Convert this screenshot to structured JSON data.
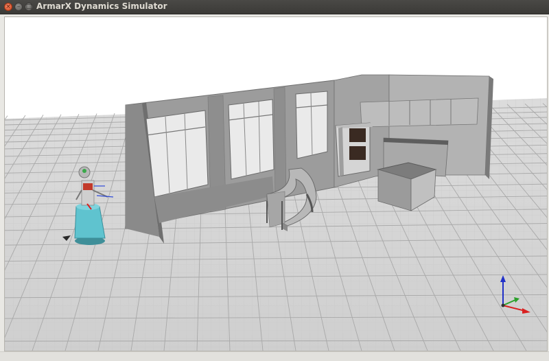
{
  "window": {
    "title": "ArmarX Dynamics Simulator",
    "close_glyph": "×",
    "minimize_glyph": "–",
    "maximize_glyph": "□"
  },
  "scene": {
    "background_color": "#ffffff",
    "floor_color": "#d8d8d8",
    "wall_color": "#8f8f8f",
    "robot_base_color": "#5fc3cf",
    "axis_colors": {
      "x": "#d92020",
      "y": "#2aa02a",
      "z": "#2030c8"
    }
  },
  "icons": [
    "close-icon",
    "minimize-icon",
    "maximize-icon"
  ]
}
